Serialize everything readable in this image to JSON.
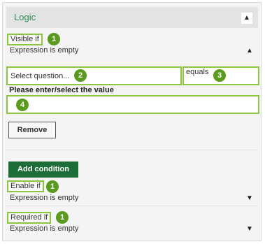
{
  "header": {
    "title": "Logic"
  },
  "visible_if": {
    "tag": "Visible if",
    "badge": "1",
    "expression": "Expression is empty"
  },
  "condition": {
    "question_placeholder": "Select question...",
    "question_badge": "2",
    "operator": "equals",
    "operator_badge": "3",
    "value_label": "Please enter/select the value",
    "value_badge": "4",
    "remove_label": "Remove"
  },
  "add_condition_label": "Add condition",
  "enable_if": {
    "tag": "Enable if",
    "badge": "1",
    "expression": "Expression is empty"
  },
  "required_if": {
    "tag": "Required if",
    "badge": "1",
    "expression": "Expression is empty"
  },
  "icons": {
    "collapse": "chevron-up-icon",
    "expand": "chevron-down-icon"
  },
  "colors": {
    "highlight": "#8cc63f",
    "badge": "#5a9a1e",
    "add_button": "#1d6d39",
    "title": "#2f8a55"
  }
}
